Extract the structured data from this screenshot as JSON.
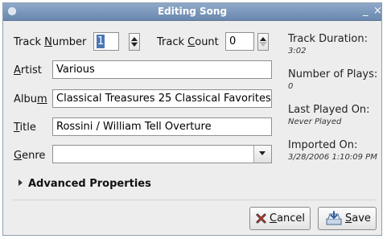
{
  "window": {
    "title": "Editing Song",
    "minimize_glyph": "_",
    "close_glyph": "×"
  },
  "fields": {
    "track_number": {
      "label_pre": "Track ",
      "label_key": "N",
      "label_post": "umber",
      "value": "1"
    },
    "track_count": {
      "label_pre": "Track ",
      "label_key": "C",
      "label_post": "ount",
      "value": "0"
    },
    "artist": {
      "label_pre": "",
      "label_key": "A",
      "label_post": "rtist",
      "value": "Various"
    },
    "album": {
      "label_pre": "Albu",
      "label_key": "m",
      "label_post": "",
      "value": "Classical Treasures 25 Classical Favorites"
    },
    "title": {
      "label_pre": "",
      "label_key": "T",
      "label_post": "itle",
      "value": "Rossini / William Tell Overture"
    },
    "genre": {
      "label_pre": "",
      "label_key": "G",
      "label_post": "enre",
      "value": ""
    }
  },
  "info": {
    "duration_label": "Track Duration:",
    "duration_value": "3:02",
    "plays_label": "Number of Plays:",
    "plays_value": "0",
    "last_played_label": "Last Played On:",
    "last_played_value": "Never Played",
    "imported_label": "Imported On:",
    "imported_value": "3/28/2006 1:10:09 PM"
  },
  "advanced": {
    "label": "Advanced Properties"
  },
  "buttons": {
    "cancel": {
      "key": "C",
      "rest": "ancel"
    },
    "save": {
      "key": "S",
      "rest": "ave"
    }
  },
  "icons": {
    "app": "app-icon",
    "cancel": "cancel-x-icon",
    "save": "save-tray-icon",
    "expander": "expander-triangle-icon"
  }
}
